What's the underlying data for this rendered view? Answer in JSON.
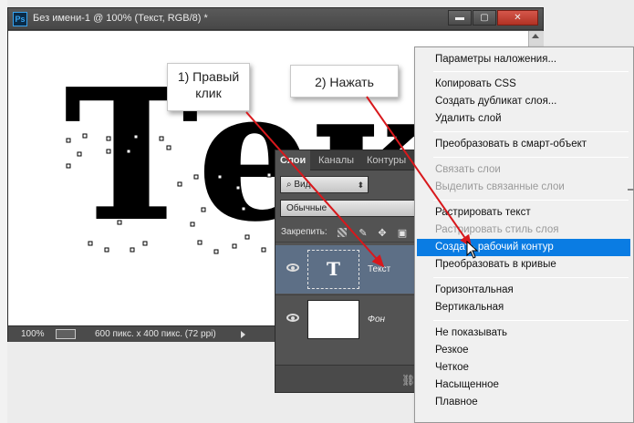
{
  "document": {
    "title": "Без имени-1 @ 100% (Текст, RGB/8) *",
    "logo": "Ps",
    "canvas_text": "Тек",
    "status": {
      "zoom": "100%",
      "size": "600 пикс. x 400 пикс. (72 ppi)"
    },
    "window_buttons": {
      "minimize": "▬",
      "maximize": "▢",
      "close": "✕"
    }
  },
  "callouts": {
    "step1": "1) Правый клик",
    "step2": "2) Нажать"
  },
  "layers_panel": {
    "tabs": [
      "Слои",
      "Каналы",
      "Контуры"
    ],
    "filter": "Вид",
    "blend_mode": "Обычные",
    "lock_label": "Закрепить:",
    "layers": [
      {
        "name": "Текст",
        "thumb": "T",
        "type": "text",
        "selected": true
      },
      {
        "name": "Фон",
        "type": "background",
        "selected": false
      }
    ]
  },
  "context_menu": {
    "items": [
      {
        "label": "Параметры наложения...",
        "disabled": false
      },
      {
        "label": "Копировать CSS",
        "disabled": false
      },
      {
        "label": "Создать дубликат слоя...",
        "disabled": false
      },
      {
        "label": "Удалить слой",
        "disabled": false
      },
      {
        "label": "Преобразовать в смарт-объект",
        "disabled": false
      },
      {
        "label": "Связать слои",
        "disabled": true
      },
      {
        "label": "Выделить связанные слои",
        "disabled": true
      },
      {
        "label": "Растрировать текст",
        "disabled": false
      },
      {
        "label": "Растрировать стиль слоя",
        "disabled": true
      },
      {
        "label": "Создать рабочий контур",
        "disabled": false,
        "selected": true
      },
      {
        "label": "Преобразовать в кривые",
        "disabled": false
      },
      {
        "label": "Горизонтальная",
        "disabled": false
      },
      {
        "label": "Вертикальная",
        "disabled": false
      },
      {
        "label": "Не показывать",
        "disabled": false
      },
      {
        "label": "Резкое",
        "disabled": false
      },
      {
        "label": "Четкое",
        "disabled": false
      },
      {
        "label": "Насыщенное",
        "disabled": false
      },
      {
        "label": "Плавное",
        "disabled": false
      }
    ]
  },
  "colors": {
    "arrow": "#d8181c",
    "menu_highlight": "#0a7ce3",
    "selected_layer": "#5d6f86",
    "close_button": "#c4402f"
  }
}
